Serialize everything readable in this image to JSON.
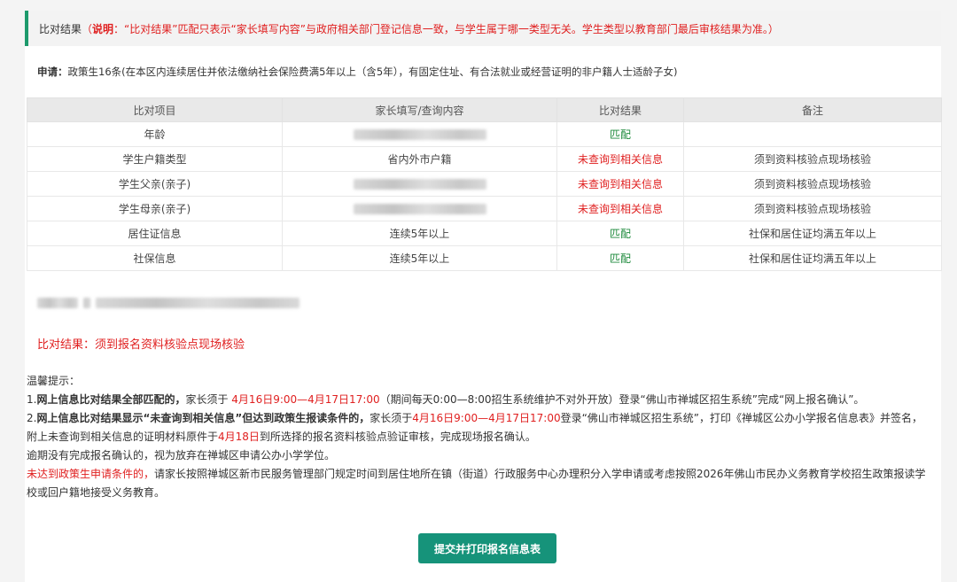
{
  "header": {
    "title": "比对结果",
    "note_open": "（",
    "note_label": "说明",
    "note_text": "：“比对结果”匹配只表示“家长填写内容”与政府相关部门登记信息一致，与学生属于哪一类型无关。学生类型以教育部门最后审核结果为准。）"
  },
  "apply": {
    "label": "申请：",
    "text": "政策生16条(在本区内连续居住并依法缴纳社会保险费满5年以上（含5年），有固定住址、有合法就业或经营证明的非户籍人士适龄子女)"
  },
  "table": {
    "headers": [
      "比对项目",
      "家长填写/查询内容",
      "比对结果",
      "备注"
    ],
    "rows": [
      {
        "item": "年龄",
        "content": "",
        "blurred": true,
        "result": "匹配",
        "status": "match",
        "note": ""
      },
      {
        "item": "学生户籍类型",
        "content": "省内外市户籍",
        "blurred": false,
        "result": "未查询到相关信息",
        "status": "nomatch",
        "note": "须到资料核验点现场核验"
      },
      {
        "item": "学生父亲(亲子)",
        "content": "",
        "blurred": true,
        "result": "未查询到相关信息",
        "status": "nomatch",
        "note": "须到资料核验点现场核验"
      },
      {
        "item": "学生母亲(亲子)",
        "content": "",
        "blurred": true,
        "result": "未查询到相关信息",
        "status": "nomatch",
        "note": "须到资料核验点现场核验"
      },
      {
        "item": "居住证信息",
        "content": "连续5年以上",
        "blurred": false,
        "result": "匹配",
        "status": "match",
        "note": "社保和居住证均满五年以上"
      },
      {
        "item": "社保信息",
        "content": "连续5年以上",
        "blurred": false,
        "result": "匹配",
        "status": "match",
        "note": "社保和居住证均满五年以上"
      }
    ]
  },
  "result": {
    "text": "比对结果：须到报名资料核验点现场核验"
  },
  "tips": {
    "heading": "温馨提示：",
    "t1_num": "1.",
    "t1_bold": "网上信息比对结果全部匹配的，",
    "t1_a": "家长须于 ",
    "t1_time": "4月16日9:00—4月17日17:00",
    "t1_b": "（期间每天0:00—8:00招生系统维护不对外开放）登录“佛山市禅城区招生系统”完成“网上报名确认”。",
    "t2_num": "2.",
    "t2_bold": "网上信息比对结果显示“未查询到相关信息”但达到政策生报读条件的，",
    "t2_a": "家长须于",
    "t2_time": "4月16日9:00—4月17日17:00",
    "t2_b": "登录“佛山市禅城区招生系统”，打印《禅城区公办小学报名信息表》并签名，附上未查询到相关信息的证明材料原件于",
    "t2_date": "4月18日",
    "t2_c": "到所选择的报名资料核验点验证审核，完成现场报名确认。",
    "t3": "逾期没有完成报名确认的，视为放弃在禅城区申请公办小学学位。",
    "t4_red": "未达到政策生申请条件的，",
    "t4_text": "请家长按照禅城区新市民服务管理部门规定时间到居住地所在镇（街道）行政服务中心办理积分入学申请或考虑按照2026年佛山市民办义务教育学校招生政策报读学校或回户籍地接受义务教育。"
  },
  "submit": {
    "label": "提交并打印报名信息表"
  },
  "colors": {
    "accent": "#1d9a6c",
    "button": "#16937a",
    "match": "#1e8a3c",
    "warning": "#e02020"
  }
}
